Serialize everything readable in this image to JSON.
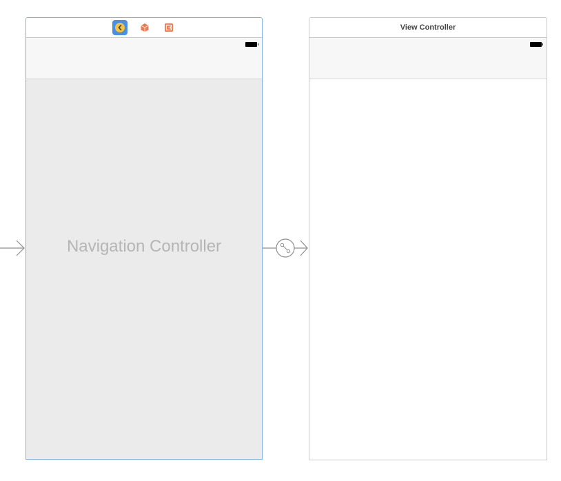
{
  "storyboard": {
    "navigation_controller": {
      "title": "Navigation Controller",
      "dock_icons": [
        "navigation-controller-icon",
        "first-responder-icon",
        "exit-icon"
      ],
      "colors": {
        "selection_border": "#7fb0e6",
        "selected_icon_bg": "#4a90e2",
        "nav_icon": "#f5c242",
        "responder_icon": "#f07a4f",
        "exit_icon": "#f07a4f",
        "background": "#ebebeb"
      }
    },
    "view_controller": {
      "title": "View Controller",
      "colors": {
        "border": "#c9c9c9",
        "navbar": "#f7f7f7"
      }
    },
    "segues": {
      "entry_point": "initial-view-controller-arrow",
      "relationship": "root-view-controller-segue"
    }
  }
}
